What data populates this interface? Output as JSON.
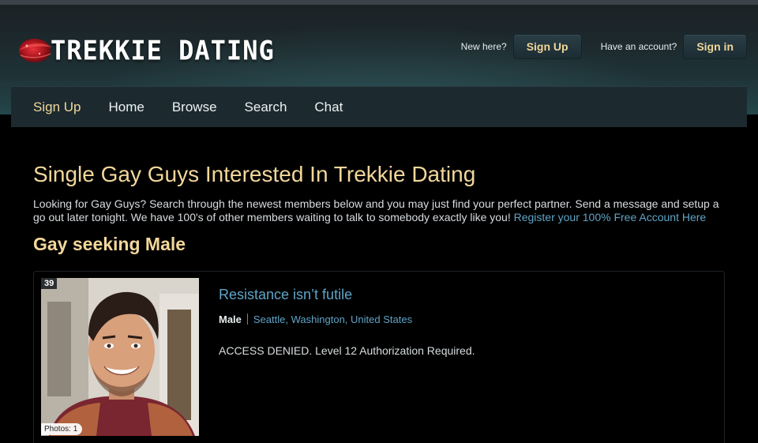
{
  "site": {
    "logo_text": "TREKKIE DATING",
    "logo_icon": "red-planet-emblem-icon"
  },
  "auth": {
    "new_here_label": "New here?",
    "signup_button": "Sign Up",
    "have_account_label": "Have an account?",
    "signin_button": "Sign in"
  },
  "nav": {
    "items": [
      {
        "label": "Sign Up",
        "active": true
      },
      {
        "label": "Home"
      },
      {
        "label": "Browse"
      },
      {
        "label": "Search"
      },
      {
        "label": "Chat"
      }
    ]
  },
  "main": {
    "title": "Single Gay Guys Interested In Trekkie Dating",
    "intro_text": "Looking for Gay Guys? Search through the newest members below and you may just find your perfect partner. Send a message and setup a go out later tonight. We have 100's of other members waiting to talk to somebody exactly like you!",
    "intro_link": "Register your 100% Free Account Here",
    "subtitle": "Gay seeking Male"
  },
  "profiles": [
    {
      "age": "39",
      "photos_label": "Photos: 1",
      "headline": "Resistance isn’t futile",
      "gender": "Male",
      "city": "Seattle",
      "region": "Washington",
      "country": "United States",
      "bio": "ACCESS DENIED. Level 12 Authorization Required."
    }
  ],
  "colors": {
    "accent_gold": "#f2d79a",
    "link_blue": "#5fa4c7",
    "nav_bg": "#1c2a30",
    "background": "#000000"
  }
}
